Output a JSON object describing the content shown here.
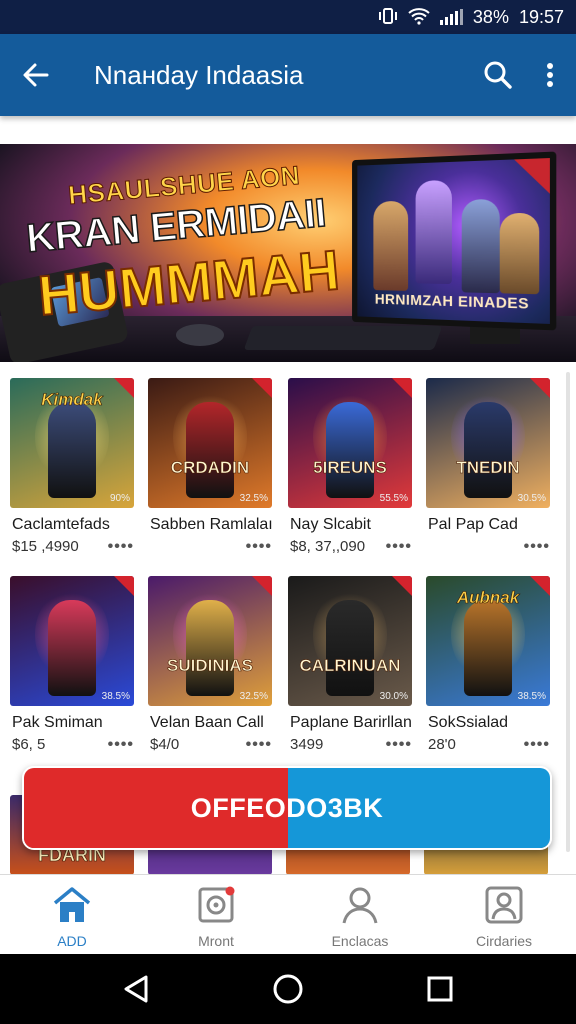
{
  "status_bar": {
    "battery": "38%",
    "time": "19:57"
  },
  "app_bar": {
    "title": "Nnaнday Indaasia"
  },
  "hero": {
    "line1": "HSAULSHUE AON",
    "line2": "KRAN ERMIDAII",
    "line3": "HUMMMAH",
    "monitor_caption": "HRNIMZAH EINADES"
  },
  "games": [
    {
      "name": "Caclamtefads",
      "price": "$15 ,4990",
      "title_top": "Kimdak",
      "title_mid": "",
      "pct": "90%",
      "colors": {
        "bg1": "#2a6b5a",
        "bg2": "#d8a53a",
        "hero": "#3c4c7a",
        "glow": "#ffe07a"
      }
    },
    {
      "name": "Sabben Ramlalaı",
      "price": "",
      "title_top": "",
      "title_mid": "CRDADIN",
      "pct": "32.5%",
      "colors": {
        "bg1": "#3a1a14",
        "bg2": "#e07a2a",
        "hero": "#b3262a",
        "glow": "#ffb45a"
      }
    },
    {
      "name": "Nay Slcabit",
      "price": "$8, 37,,090",
      "title_top": "",
      "title_mid": "5IREUNS",
      "pct": "55.5%",
      "colors": {
        "bg1": "#2a0e4a",
        "bg2": "#e23a3a",
        "hero": "#3a6ad8",
        "glow": "#ff9a3a"
      }
    },
    {
      "name": "Pal Pap Cad",
      "price": "",
      "title_top": "",
      "title_mid": "TNEDIN",
      "pct": "30.5%",
      "colors": {
        "bg1": "#1b2a4a",
        "bg2": "#f0b060",
        "hero": "#2a3a6a",
        "glow": "#8a6aff"
      }
    },
    {
      "name": "Pak Smiman",
      "price": "$6, 5",
      "title_top": "",
      "title_mid": "",
      "pct": "38.5%",
      "colors": {
        "bg1": "#3a0e2a",
        "bg2": "#2a4ad8",
        "hero": "#d83a5a",
        "glow": "#ff5a8a"
      }
    },
    {
      "name": "Velan Baan Call",
      "price": "$4/0",
      "title_top": "",
      "title_mid": "SUIDINIAS",
      "pct": "32.5%",
      "colors": {
        "bg1": "#4a1a6a",
        "bg2": "#e0a03a",
        "hero": "#e0b04a",
        "glow": "#ff6ad8"
      }
    },
    {
      "name": "Paplane Barirllan",
      "price": "3499",
      "title_top": "",
      "title_mid": "CALRINUAN",
      "pct": "30.0%",
      "colors": {
        "bg1": "#1a1a1a",
        "bg2": "#6a5a4a",
        "hero": "#2a2a2a",
        "glow": "#c8a060"
      }
    },
    {
      "name": "SokSsialad",
      "price": "28'0",
      "title_top": "Aubnak",
      "title_mid": "",
      "pct": "38.5%",
      "colors": {
        "bg1": "#2a4a2a",
        "bg2": "#3a7ad8",
        "hero": "#b8742a",
        "glow": "#ffd06a"
      }
    }
  ],
  "peek_labels": [
    "FDARIN"
  ],
  "offer": {
    "label": "OFFEODO3BK",
    "left_color": "#df2a2a",
    "right_color": "#1597d8"
  },
  "bottom_nav": [
    {
      "label": "ADD",
      "icon": "home-icon",
      "active": true
    },
    {
      "label": "Mront",
      "icon": "media-icon",
      "active": false
    },
    {
      "label": "Enclacas",
      "icon": "profile-icon",
      "active": false
    },
    {
      "label": "Cirdaries",
      "icon": "account-icon",
      "active": false
    }
  ]
}
